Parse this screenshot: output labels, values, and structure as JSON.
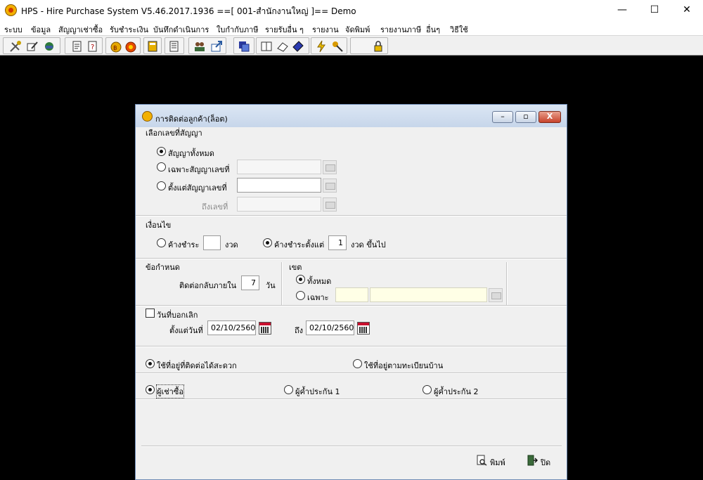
{
  "window": {
    "title": "HPS - Hire Purchase System V5.46.2017.1936 ==[ 001-สำนักงานใหญ่ ]== Demo",
    "minimize": "—",
    "maximize": "☐",
    "close": "✕"
  },
  "menu": [
    "ระบบ",
    "ข้อมูล",
    "สัญญาเช่าซื้อ",
    "รับชำระเงิน",
    "บันทึกดำเนินการ",
    "ใบกำกับภาษี",
    "รายรับอื่น ๆ",
    "รายงาน",
    "จัดพิมพ์",
    "รายงานภาษี",
    "อื่นๆ",
    "วิธีใช้"
  ],
  "dialog": {
    "title": "การติดต่อลูกค้า(ล็อต)",
    "minimize": "–",
    "restore": "▫",
    "close": "X",
    "contract": {
      "heading": "เลือกเลขที่สัญญา",
      "all": "สัญญาทั้งหมด",
      "only": "เฉพาะสัญญาเลขที่",
      "from": "ตั้งแต่สัญญาเลขที่",
      "to": "ถึงเลขที่",
      "only_value": "",
      "from_value": "",
      "to_value": ""
    },
    "condition": {
      "heading": "เงื่อนไข",
      "overdue": "ค้างชำระ",
      "overdue_value": "",
      "overdue_unit": "งวด",
      "overdue_from": "ค้างชำระตั้งแต่",
      "overdue_from_value": "1",
      "overdue_from_unit": "งวด ขึ้นไป"
    },
    "rule": {
      "heading": "ข้อกำหนด",
      "callback_label": "ติดต่อกลับภายใน",
      "callback_value": "7",
      "callback_unit": "วัน"
    },
    "zone": {
      "heading": "เขต",
      "all": "ทั้งหมด",
      "only": "เฉพาะ",
      "code": "",
      "name": ""
    },
    "cancel_date": {
      "label": "วันที่บอกเลิก",
      "from_label": "ตั้งแต่วันที่",
      "from_value": "02/10/2560",
      "to_label": "ถึง",
      "to_value": "02/10/2560"
    },
    "address": {
      "convenient": "ใช้ที่อยู่ที่ติดต่อได้สะดวก",
      "registered": "ใช้ที่อยู่ตามทะเบียนบ้าน"
    },
    "person": {
      "hirer": "ผู้เช่าซื้อ",
      "guarantor1": "ผู้ค้ำประกัน 1",
      "guarantor2": "ผู้ค้ำประกัน 2"
    },
    "buttons": {
      "print": "พิมพ์",
      "close": "ปิด"
    }
  },
  "colors": {
    "desktop": "#000000",
    "accent": "#6e8bb5"
  }
}
